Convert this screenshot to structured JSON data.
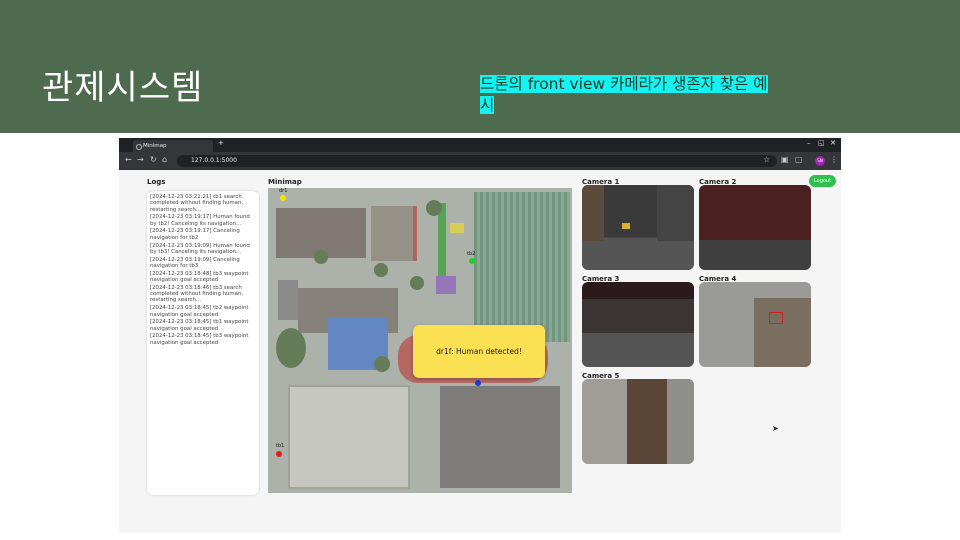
{
  "slide": {
    "title": "관제시스템",
    "caption": "드론의 front view 카메라가 생존자 찾은 예시"
  },
  "browser": {
    "tab_title": "Minimap",
    "new_tab": "+",
    "url": "127.0.0.1:5000",
    "profile_initials": "SN",
    "minimize": "–",
    "maximize": "◱",
    "close": "✕"
  },
  "app": {
    "logs_label": "Logs",
    "minimap_label": "Minimap",
    "logout_label": "Logout",
    "logs": [
      "[2024-12-23 03:21:21] tb1 search completed without finding human, restarting search...",
      "[2024-12-23 03:19:17] Human found by tb2! Canceling its navigation...",
      "[2024-12-23 03:19:17] Canceling navigation for tb2",
      "[2024-12-23 03:19:09] Human found by tb3! Canceling its navigation...",
      "[2024-12-23 03:19:09] Canceling navigation for tb3",
      "[2024-12-23 03:18:48] tb3 waypoint navigation goal accepted",
      "[2024-12-23 03:18:46] tb3 search completed without finding human, restarting search...",
      "[2024-12-23 03:18:45] tb2 waypoint navigation goal accepted",
      "[2024-12-23 03:18:45] tb1 waypoint navigation goal accepted",
      "[2024-12-23 03:18:45] tb3 waypoint navigation goal accepted"
    ],
    "minimap_markers": {
      "dr1": "dr1",
      "tb2": "tb2",
      "tb1": "tb1"
    },
    "alert_text": "dr1f: Human detected!",
    "cameras": [
      "Camera 1",
      "Camera 2",
      "Camera 3",
      "Camera 4",
      "Camera 5"
    ]
  },
  "colors": {
    "header_bg": "#4f6b4f",
    "caption_highlight": "#14f2f2",
    "alert_bg": "#fbe053",
    "logout_bg": "#2fbf4f",
    "marker_dr1": "#f2e400",
    "marker_tb2": "#19d619",
    "marker_tb3": "#1a3bd6",
    "marker_tb1": "#e61c1c"
  }
}
